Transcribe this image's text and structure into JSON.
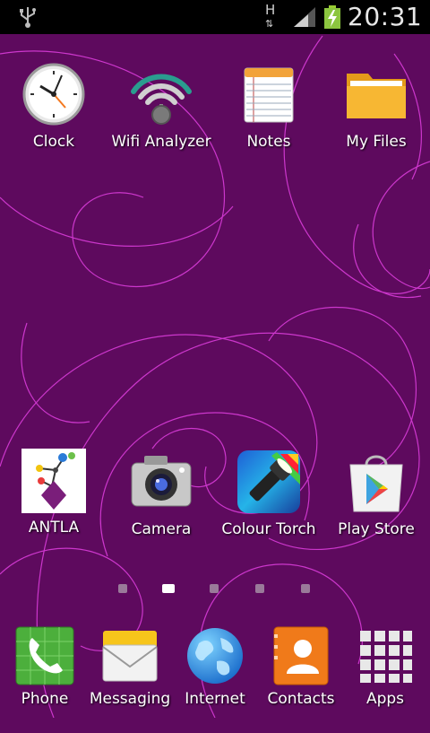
{
  "status_bar": {
    "time": "20:31",
    "network_type": "H",
    "icons": [
      "usb-icon",
      "network-h-icon",
      "signal-icon",
      "battery-charging-icon"
    ]
  },
  "home": {
    "row1": [
      {
        "label": "Clock",
        "icon": "clock-icon"
      },
      {
        "label": "Wifi Analyzer",
        "icon": "wifi-analyzer-icon"
      },
      {
        "label": "Notes",
        "icon": "notes-icon"
      },
      {
        "label": "My Files",
        "icon": "folder-icon"
      }
    ],
    "row2": [
      {
        "label": "ANTLA",
        "icon": "antla-icon"
      },
      {
        "label": "Camera",
        "icon": "camera-icon"
      },
      {
        "label": "Colour Torch",
        "icon": "torch-icon"
      },
      {
        "label": "Play Store",
        "icon": "play-store-icon"
      }
    ],
    "pages": 5,
    "active_page": 2
  },
  "dock": [
    {
      "label": "Phone",
      "icon": "phone-icon"
    },
    {
      "label": "Messaging",
      "icon": "messaging-icon"
    },
    {
      "label": "Internet",
      "icon": "globe-icon"
    },
    {
      "label": "Contacts",
      "icon": "contacts-icon"
    },
    {
      "label": "Apps",
      "icon": "apps-grid-icon"
    }
  ],
  "colors": {
    "wallpaper": "#5e0a5e",
    "swirl": "#e040e0",
    "status_bar": "#000000"
  }
}
